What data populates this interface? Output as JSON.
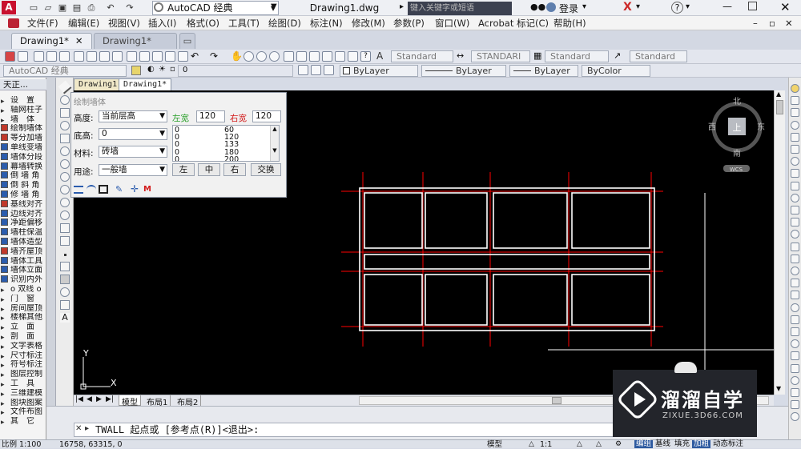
{
  "title_bar": {
    "workspace": "AutoCAD 经典",
    "document": "Drawing1.dwg",
    "search_placeholder": "键入关键字或短语",
    "login": "登录",
    "help": "?"
  },
  "menu": [
    "文件(F)",
    "编辑(E)",
    "视图(V)",
    "插入(I)",
    "格式(O)",
    "工具(T)",
    "绘图(D)",
    "标注(N)",
    "修改(M)",
    "参数(P)",
    "窗口(W)",
    "Acrobat 标记(C)",
    "帮助(H)"
  ],
  "doc_tabs": [
    "Drawing1*",
    "Drawing1*"
  ],
  "toolbar": {
    "text_style1": "Standard",
    "dim_style": "STANDARI",
    "table_style": "Standard",
    "mleader_style": "Standard",
    "workspace2": "AutoCAD 经典",
    "layer": "0",
    "color": "ByLayer",
    "linetype": "ByLayer",
    "lineweight": "ByLayer",
    "plotstyle": "ByColor"
  },
  "left_panel": {
    "header": "天正...",
    "items": [
      "设　置",
      "轴网柱子",
      "墙　体",
      "绘制墙体",
      "等分加墙",
      "单线变墙",
      "墙体分段",
      "幕墙转换",
      "倒 墙 角",
      "倒 斜 角",
      "修 墙 角",
      "基线对齐",
      "边线对齐",
      "净距偏移",
      "墙柱保温",
      "墙体造型",
      "墙齐屋顶",
      "墙体工具",
      "墙体立面",
      "识别内外",
      "o 双线 o",
      "门　窗",
      "房间屋顶",
      "楼梯其他",
      "立　面",
      "剖　面",
      "文字表格",
      "尺寸标注",
      "符号标注",
      "图层控制",
      "工　具",
      "三维建模",
      "图块图案",
      "文件布图",
      "其　它"
    ]
  },
  "inner_tabs": [
    "Drawing1",
    "Drawing1*"
  ],
  "dialog": {
    "title": "绘制墙体",
    "height_label": "高度:",
    "height_value": "当前层高",
    "left_width_label": "左宽",
    "left_width_value": "120",
    "right_width_label": "右宽",
    "right_width_value": "120",
    "base_label": "底高:",
    "base_value": "0",
    "material_label": "材料:",
    "material_value": "砖墙",
    "usage_label": "用途:",
    "usage_value": "一般墙",
    "width_list": [
      [
        "0",
        "60"
      ],
      [
        "0",
        "120"
      ],
      [
        "0",
        "133"
      ],
      [
        "0",
        "180"
      ],
      [
        "0",
        "200"
      ]
    ],
    "btn_left": "左",
    "btn_center": "中",
    "btn_right": "右",
    "btn_swap": "交换"
  },
  "viewcube": {
    "north": "北",
    "south": "南",
    "west": "西",
    "east": "东",
    "top": "上",
    "wcs": "WCS"
  },
  "ucs": {
    "x": "X",
    "y": "Y"
  },
  "layout_tabs": [
    "模型",
    "布局1",
    "布局2"
  ],
  "command": {
    "prompt": "TWALL 起点或 [参考点(R)]<退出>:"
  },
  "status": {
    "scale": "比例 1:100",
    "coords": "16758,  63315, 0",
    "model": "模型",
    "anno_scale": "1:1",
    "right_items": [
      "编组",
      "基线",
      "填充",
      "加粗",
      "动态标注"
    ]
  },
  "watermark": {
    "brand": "溜溜自学",
    "url": "ZIXUE.3D66.COM"
  }
}
